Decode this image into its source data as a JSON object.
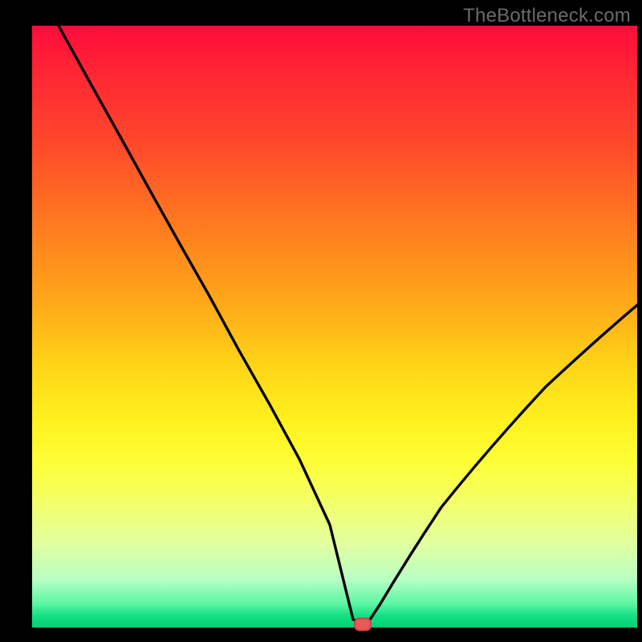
{
  "watermark": "TheBottleneck.com",
  "chart_data": {
    "type": "line",
    "title": "",
    "xlabel": "",
    "ylabel": "",
    "xlim": [
      0,
      100
    ],
    "ylim": [
      0,
      100
    ],
    "x": [
      0,
      5,
      10,
      15,
      20,
      25,
      30,
      35,
      40,
      45,
      48,
      50,
      52,
      53,
      55,
      60,
      65,
      70,
      75,
      80,
      85,
      90,
      95,
      100
    ],
    "values": [
      100,
      91,
      82,
      73,
      64,
      55,
      46,
      37,
      28,
      17,
      8,
      2,
      0,
      0,
      3,
      12,
      20,
      27,
      33,
      38,
      43,
      47,
      51,
      55
    ],
    "min_marker": {
      "x": 52,
      "y": 0
    },
    "gradient_stops": [
      {
        "pos": 0,
        "color": "#ff0b3d"
      },
      {
        "pos": 50,
        "color": "#ffd317"
      },
      {
        "pos": 75,
        "color": "#fdff3a"
      },
      {
        "pos": 100,
        "color": "#00cf75"
      }
    ]
  }
}
